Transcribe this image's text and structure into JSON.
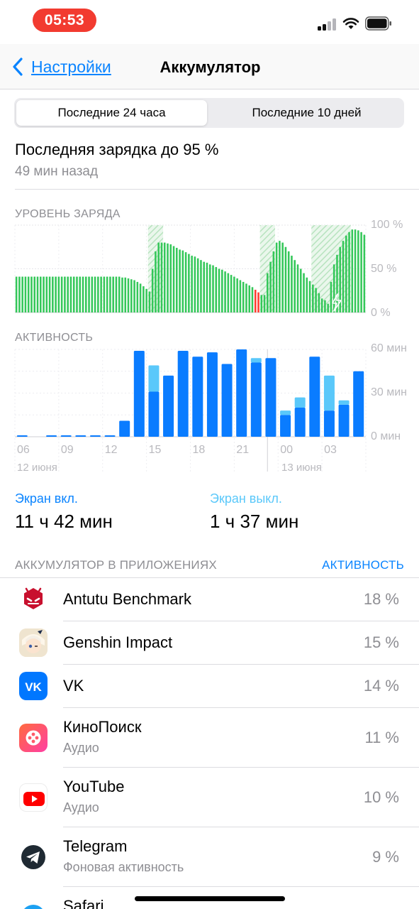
{
  "status_bar": {
    "time": "05:53",
    "icons": [
      "cellular-signal-icon",
      "wifi-icon",
      "battery-icon"
    ]
  },
  "nav": {
    "back_label": "Настройки",
    "title": "Аккумулятор"
  },
  "segmented": {
    "options": [
      "Последние 24 часа",
      "Последние 10 дней"
    ],
    "selected": "Последние 24 часа"
  },
  "last_charge": {
    "text": "Последняя зарядка до 95 %",
    "time_ago": "49 мин назад"
  },
  "charts": {
    "battery_level": {
      "label": "УРОВЕНЬ ЗАРЯДА",
      "y_ticks": [
        "100 %",
        "50 %",
        "0 %"
      ]
    },
    "activity": {
      "label": "АКТИВНОСТЬ",
      "y_ticks": [
        "60 мин",
        "30 мин",
        "0 мин"
      ],
      "x_ticks": [
        "06",
        "09",
        "12",
        "15",
        "18",
        "21",
        "00",
        "03"
      ],
      "dates": [
        "12 июня",
        "13 июня"
      ]
    }
  },
  "chart_data": [
    {
      "type": "bar",
      "title": "УРОВЕНЬ ЗАРЯДА",
      "ylim": [
        0,
        100
      ],
      "y_unit": "%",
      "values": [
        41,
        41,
        41,
        41,
        41,
        41,
        41,
        41,
        41,
        41,
        41,
        41,
        41,
        41,
        41,
        41,
        41,
        41,
        41,
        41,
        41,
        41,
        41,
        41,
        41,
        41,
        41,
        41,
        41,
        41,
        41,
        41,
        41,
        41,
        41,
        40,
        40,
        39,
        38,
        37,
        35,
        33,
        30,
        27,
        24,
        50,
        70,
        80,
        80,
        80,
        79,
        78,
        76,
        74,
        72,
        71,
        69,
        67,
        65,
        64,
        62,
        60,
        58,
        57,
        55,
        54,
        52,
        50,
        49,
        47,
        45,
        43,
        41,
        39,
        37,
        35,
        33,
        31,
        29,
        26,
        23,
        20,
        20,
        45,
        58,
        70,
        80,
        82,
        80,
        75,
        70,
        65,
        60,
        55,
        50,
        45,
        40,
        36,
        32,
        28,
        22,
        16,
        14,
        10,
        35,
        55,
        66,
        75,
        82,
        88,
        92,
        95,
        95,
        94,
        92,
        89
      ],
      "low_indices": [
        79,
        80
      ],
      "charging_periods": [
        [
          44,
          48
        ],
        [
          81,
          85
        ],
        [
          98,
          110
        ]
      ]
    },
    {
      "type": "bar",
      "title": "АКТИВНОСТЬ",
      "ylim": [
        0,
        60
      ],
      "y_unit": "мин",
      "x_ticks": [
        "06",
        "09",
        "12",
        "15",
        "18",
        "21",
        "00",
        "03"
      ],
      "series": [
        {
          "name": "Экран вкл.",
          "values": [
            1,
            0,
            1,
            1,
            1,
            1,
            1,
            11,
            59,
            31,
            42,
            59,
            55,
            58,
            50,
            60,
            51,
            54,
            15,
            20,
            55,
            18,
            22,
            45
          ]
        },
        {
          "name": "Экран выкл.",
          "values": [
            0,
            0,
            0,
            0,
            0,
            0,
            0,
            0,
            0,
            18,
            0,
            0,
            0,
            0,
            0,
            0,
            3,
            0,
            3,
            7,
            0,
            24,
            3,
            0
          ]
        }
      ]
    }
  ],
  "screen": {
    "on_label": "Экран вкл.",
    "on_value": "11 ч 42 мин",
    "off_label": "Экран выкл.",
    "off_value": "1 ч 37 мин"
  },
  "apps": {
    "header": "АККУМУЛЯТОР В ПРИЛОЖЕНИЯХ",
    "toggle": "АКТИВНОСТЬ",
    "items": [
      {
        "name": "Antutu Benchmark",
        "sub": "",
        "percent": "18 %",
        "icon": "antutu-icon"
      },
      {
        "name": "Genshin Impact",
        "sub": "",
        "percent": "15 %",
        "icon": "genshin-icon"
      },
      {
        "name": "VK",
        "sub": "",
        "percent": "14 %",
        "icon": "vk-icon"
      },
      {
        "name": "КиноПоиск",
        "sub": "Аудио",
        "percent": "11 %",
        "icon": "kinopoisk-icon"
      },
      {
        "name": "YouTube",
        "sub": "Аудио",
        "percent": "10 %",
        "icon": "youtube-icon"
      },
      {
        "name": "Telegram",
        "sub": "Фоновая активность",
        "percent": "9 %",
        "icon": "telegram-icon"
      },
      {
        "name": "Safari",
        "sub": "",
        "percent": "",
        "icon": "safari-icon"
      }
    ]
  },
  "colors": {
    "accent": "#0a84ff",
    "battery_green": "#34c759",
    "battery_low": "#ff3b30",
    "activity_screen_on": "#0a7cff",
    "activity_screen_off": "#5ac8fa"
  }
}
